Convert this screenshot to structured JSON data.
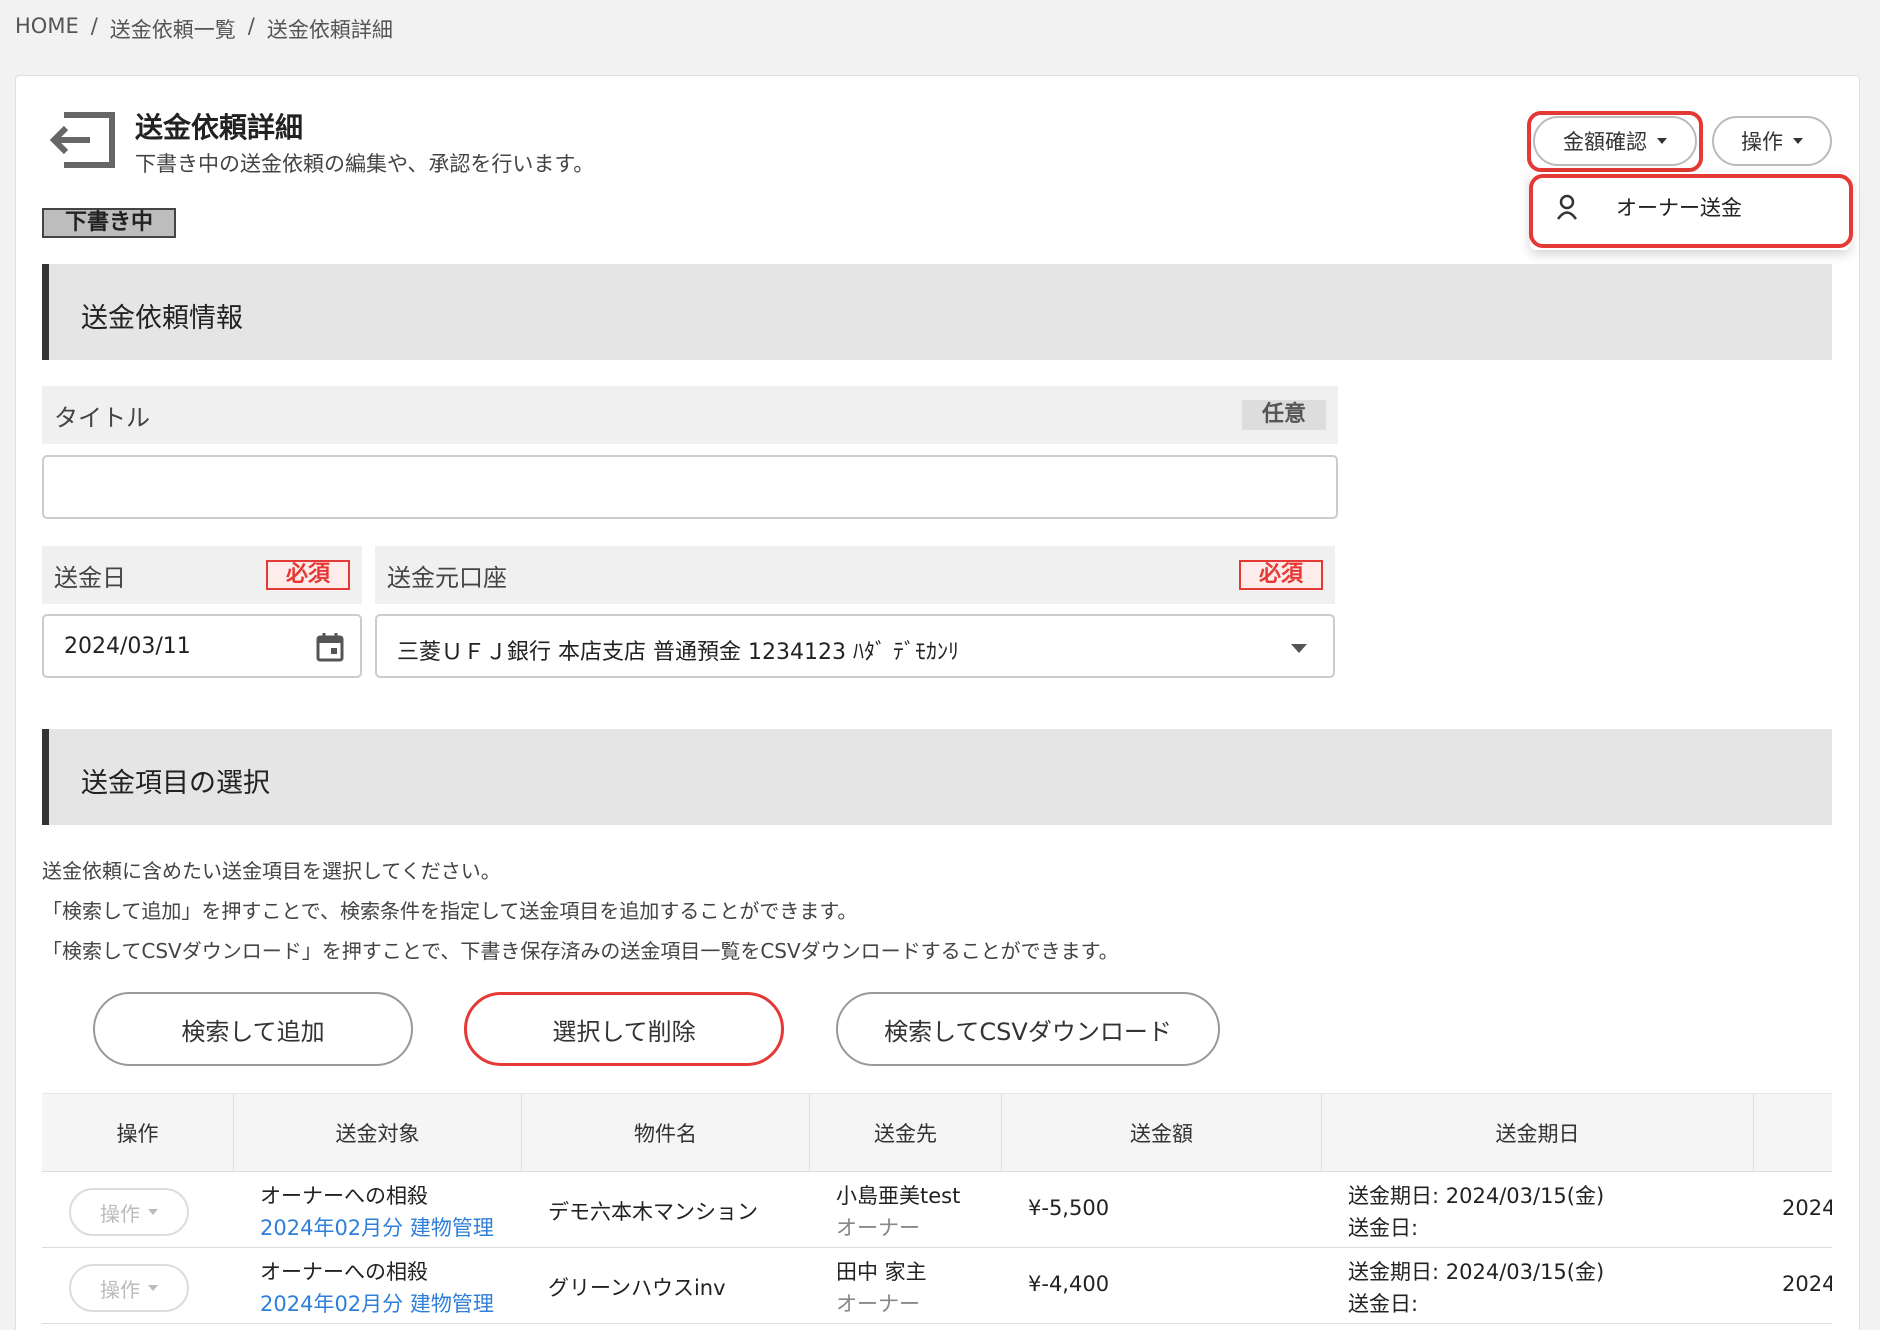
{
  "breadcrumb": {
    "home": "HOME",
    "list": "送金依頼一覧",
    "current": "送金依頼詳細",
    "sep": "/"
  },
  "header": {
    "title": "送金依頼詳細",
    "description": "下書き中の送金依頼の編集や、承認を行います。",
    "status": "下書き中"
  },
  "toolbar": {
    "amount_check": "金額確認",
    "operations": "操作"
  },
  "dropdown": {
    "owner_remit": "オーナー送金"
  },
  "section_info": {
    "title": "送金依頼情報"
  },
  "form": {
    "title_label": "タイトル",
    "optional": "任意",
    "date_label": "送金日",
    "required": "必須",
    "date_value": "2024/03/11",
    "account_label": "送金元口座",
    "account_value": "三菱ＵＦＪ銀行 本店支店 普通預金 1234123 ﾊﾀﾞ ﾃﾞﾓｶﾝﾘ"
  },
  "section_items": {
    "title": "送金項目の選択",
    "help": [
      "送金依頼に含めたい送金項目を選択してください。",
      "「検索して追加」を押すことで、検索条件を指定して送金項目を追加することができます。",
      "「検索してCSVダウンロード」を押すことで、下書き保存済みの送金項目一覧をCSVダウンロードすることができます。"
    ],
    "btn_search_add": "検索して追加",
    "btn_select_delete": "選択して削除",
    "btn_search_csv": "検索してCSVダウンロード"
  },
  "table": {
    "headers": [
      "操作",
      "送金対象",
      "物件名",
      "送金先",
      "送金額",
      "送金期日"
    ],
    "rows": [
      {
        "op": "操作",
        "target": "オーナーへの相殺",
        "target_link": "2024年02月分 建物管理",
        "property": "デモ六本木マンション",
        "payee": "小島亜美test",
        "payee_role": "オーナー",
        "amount": "¥-5,500",
        "due": "送金期日: 2024/03/15(金)",
        "date": "送金日:",
        "extra": "2024"
      },
      {
        "op": "操作",
        "target": "オーナーへの相殺",
        "target_link": "2024年02月分 建物管理",
        "property": "グリーンハウスinv",
        "payee": "田中 家主",
        "payee_role": "オーナー",
        "amount": "¥-4,400",
        "due": "送金期日: 2024/03/15(金)",
        "date": "送金日:",
        "extra": "2024"
      }
    ]
  },
  "colors": {
    "accent_red": "#e53935",
    "link_blue": "#2f7fd9"
  }
}
